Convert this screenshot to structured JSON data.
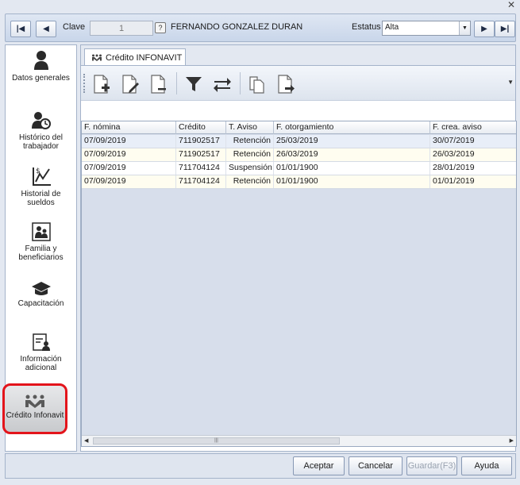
{
  "header": {
    "clave_label": "Clave",
    "clave_value": "1",
    "employee_name": "FERNANDO GONZALEZ DURAN",
    "estatus_label": "Estatus",
    "estatus_value": "Alta"
  },
  "sidebar": {
    "items": [
      {
        "label": "Datos generales",
        "icon": "person-icon"
      },
      {
        "label": "Histórico del trabajador",
        "icon": "history-person-icon"
      },
      {
        "label": "Historial de sueldos",
        "icon": "salary-chart-icon"
      },
      {
        "label": "Familia y beneficiarios",
        "icon": "family-icon"
      },
      {
        "label": "Capacitación",
        "icon": "graduation-cap-icon"
      },
      {
        "label": "Información adicional",
        "icon": "info-document-icon"
      },
      {
        "label": "Crédito Infonavit",
        "icon": "infonavit-icon",
        "selected": true
      }
    ]
  },
  "tab": {
    "label": "Crédito INFONAVIT"
  },
  "grid": {
    "columns": [
      "F. nómina",
      "Crédito",
      "T. Aviso",
      "F. otorgamiento",
      "F. crea. aviso"
    ],
    "rows": [
      [
        "07/09/2019",
        "711902517",
        "Retención",
        "25/03/2019",
        "30/07/2019"
      ],
      [
        "07/09/2019",
        "711902517",
        "Retención",
        "26/03/2019",
        "26/03/2019"
      ],
      [
        "07/09/2019",
        "711704124",
        "Suspensión",
        "01/01/1900",
        "28/01/2019"
      ],
      [
        "07/09/2019",
        "711704124",
        "Retención",
        "01/01/1900",
        "01/01/2019"
      ]
    ]
  },
  "footer": {
    "aceptar": "Aceptar",
    "cancelar": "Cancelar",
    "guardar": "Guardar(F3)",
    "ayuda": "Ayuda"
  },
  "colors": {
    "selected_border": "#e3141b",
    "row_alt": "#fffdf0",
    "row_first": "#e8eef8"
  }
}
